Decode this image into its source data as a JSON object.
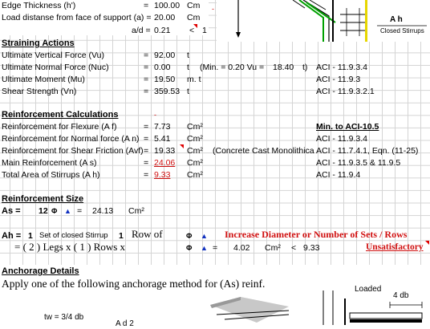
{
  "geometry_inputs": {
    "edge_thickness": {
      "label": "Edge Thickness (h')",
      "eq": "=",
      "value": "100.00",
      "unit": "Cm"
    },
    "load_distance": {
      "label": "Load distanse from face of support (a) =",
      "value": "20.00",
      "unit": "Cm"
    },
    "ad_ratio": {
      "label": "a/d =",
      "value": "0.21",
      "cmp": "<",
      "limit": "1"
    }
  },
  "straining": {
    "title": "Straining Actions",
    "rows": [
      {
        "label": "Ultimate Vertical Force (Vu)",
        "eq": "=",
        "value": "92.00",
        "unit": "t",
        "note": "",
        "ref": ""
      },
      {
        "label": "Ultimate Normal Force (Nuc)",
        "eq": "=",
        "value": "0.00",
        "unit": "t",
        "note": "(Min. = 0.20 Vu =",
        "note_val": "18.40",
        "note_unit": "t)",
        "ref": "ACI - 11.9.3.4"
      },
      {
        "label": "Ultimate Moment (Mu)",
        "eq": "=",
        "value": "19.50",
        "unit": "m. t",
        "note": "",
        "ref": "ACI - 11.9.3"
      },
      {
        "label": "Shear Strength (Vn)",
        "eq": "=",
        "value": "359.53",
        "unit": "t",
        "note": "",
        "ref": "ACI - 11.9.3.2.1"
      }
    ]
  },
  "reinforcement_calc": {
    "title": "Reinforcement Calculations",
    "min_title": "Min. to ACI-10.5",
    "rows": [
      {
        "label": "Reinforcement for Flexure (A f)",
        "eq": "=",
        "value": "7.73",
        "unit": "Cm²",
        "note": "",
        "ref": ""
      },
      {
        "label": "Reinforcement for Normal force (A n)",
        "eq": "=",
        "value": "5.41",
        "unit": "Cm²",
        "note": "",
        "ref": "ACI - 11.9.3.4"
      },
      {
        "label": "Reinforcement for Shear Friction (Avf)",
        "eq": "=",
        "value": "19.33",
        "unit": "Cm²",
        "note": "(Concrete Cast Monolithically",
        "ref": "ACI - 11.7.4.1, Eqn. (11-25)"
      },
      {
        "label": "Main Reinforcement (A s)",
        "eq": "=",
        "value": "24.06",
        "unit": "Cm²",
        "note": "",
        "ref": "ACI - 11.9.3.5 & 11.9.5"
      },
      {
        "label": "Total Area of Stirrups (A h)",
        "eq": "=",
        "value": "9.33",
        "unit": "Cm²",
        "note": "",
        "ref": "ACI - 11.9.4"
      }
    ]
  },
  "reinf_size": {
    "title": "Reinforcement Size",
    "as_label": "As =",
    "as_count": "12",
    "bar_symbol": "Φ",
    "eq": "=",
    "as_area": "24.13",
    "as_unit": "Cm²",
    "ah_label": "Ah =",
    "ah_count": "1",
    "ah_text": "Set of closed Stirrup",
    "ah_rows": "1",
    "row_of": "Row   of",
    "ah_message": "Increase Diameter or Number of  Sets / Rows",
    "legs_text": "=    ( 2 )  Legs  x  ( 1 )  Rows  x",
    "ah_area": "4.02",
    "ah_unit": "Cm²",
    "ah_cmp": "<",
    "ah_req": "9.33",
    "status": "Unsatisfactory"
  },
  "anchorage": {
    "title": "Anchorage Details",
    "subtitle": "Apply one of the following anchorage method for (As) reinf.",
    "loaded_label": "Loaded",
    "dim_label": "4 db",
    "tw_label": "tw = 3/4 db",
    "partial_label": "A   d  2"
  },
  "diagram": {
    "ah_label": "A h",
    "closed_stirrups": "Closed Stirrups"
  },
  "colors": {
    "red": "#d01010",
    "grid": "#d4d4d4",
    "rebar": "#00a000",
    "bar_yellow": "#e6d600"
  }
}
